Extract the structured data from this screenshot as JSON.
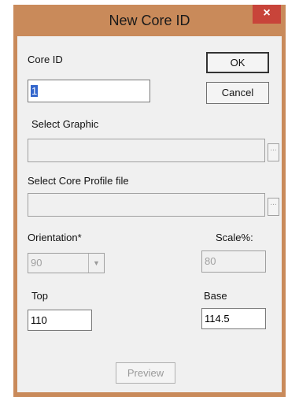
{
  "window": {
    "title": "New Core ID",
    "close_glyph": "×"
  },
  "core_id": {
    "label": "Core ID",
    "value": "1"
  },
  "buttons": {
    "ok_label": "OK",
    "cancel_label": "Cancel",
    "preview_label": "Preview"
  },
  "graphic": {
    "label": "Select Graphic",
    "value": "",
    "browse_label": "..."
  },
  "profile": {
    "label": "Select Core Profile file",
    "value": "",
    "browse_label": "..."
  },
  "orientation": {
    "label": "Orientation*",
    "value": "90"
  },
  "scale": {
    "label": "Scale%:",
    "value": "80"
  },
  "top": {
    "label": "Top",
    "value": "110"
  },
  "base": {
    "label": "Base",
    "value": "114.5"
  },
  "colors": {
    "title_bar": "#c98a5a",
    "close_button": "#c8443a",
    "client_bg": "#f0f0f0"
  },
  "icons": {
    "close": "close-icon",
    "dropdown": "chevron-down-icon"
  }
}
